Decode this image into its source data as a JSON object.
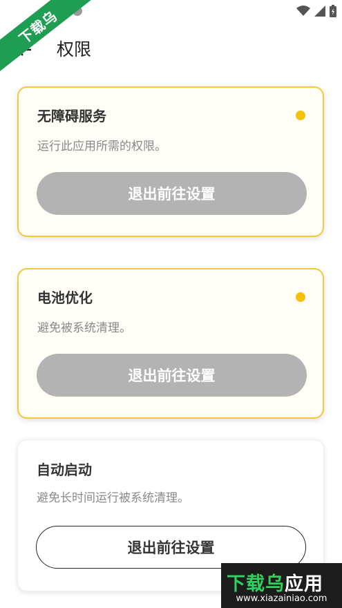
{
  "watermark": {
    "ribbon_text": "下载乌",
    "bottom_brand": "下载乌",
    "bottom_suffix": "应用",
    "bottom_url": "www.xiazainiao.com"
  },
  "app_bar": {
    "title": "权限"
  },
  "cards": [
    {
      "title": "无障碍服务",
      "description": "运行此应用所需的权限。",
      "button_label": "退出前往设置",
      "status_color": "#f5c10f"
    },
    {
      "title": "电池优化",
      "description": "避免被系统清理。",
      "button_label": "退出前往设置",
      "status_color": "#f5c10f"
    },
    {
      "title": "自动启动",
      "description": "避免长时间运行被系统清理。",
      "button_label": "退出前往设置"
    }
  ],
  "colors": {
    "accent": "#f3c93a",
    "button_disabled": "#b3b3b3",
    "brand_green": "#1f9e53"
  }
}
